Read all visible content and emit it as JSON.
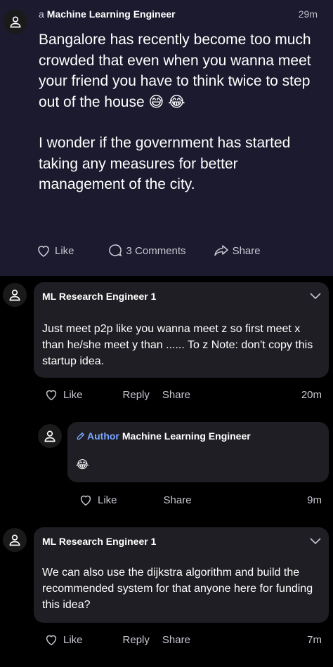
{
  "post": {
    "prefix": "a",
    "author": "Machine Learning Engineer",
    "time": "29m",
    "paragraph1": "Bangalore has recently become too much crowded that even when you wanna meet your friend you have to think twice to step out of the house 😅 😂",
    "paragraph2": "I wonder if the government has started taking any measures for better management of the city.",
    "like_label": "Like",
    "comments_label": "3 Comments",
    "share_label": "Share"
  },
  "comments": [
    {
      "author": "ML Research Engineer 1",
      "text": "Just meet p2p like you wanna meet z so first meet x than he/she meet y than ...... To z Note: don't copy this startup idea.",
      "like_label": "Like",
      "reply_label": "Reply",
      "share_label": "Share",
      "time": "20m"
    },
    {
      "badge": "Author",
      "author": "Machine Learning Engineer",
      "text": "😂",
      "like_label": "Like",
      "share_label": "Share",
      "time": "9m"
    },
    {
      "author": "ML Research Engineer 1",
      "text": "We can also use the dijkstra algorithm and build the recommended system for that anyone here for funding this idea?",
      "like_label": "Like",
      "reply_label": "Reply",
      "share_label": "Share",
      "time": "7m"
    }
  ],
  "colors": {
    "post_background": "#1b1a2e",
    "page_background": "#000000",
    "bubble_background": "#1e1e24",
    "author_badge": "#7aa7ff",
    "muted_text": "#c7c7d2"
  },
  "icons": [
    "user-icon",
    "heart-icon",
    "comment-icon",
    "share-icon",
    "chevron-down-icon",
    "pen-icon"
  ]
}
